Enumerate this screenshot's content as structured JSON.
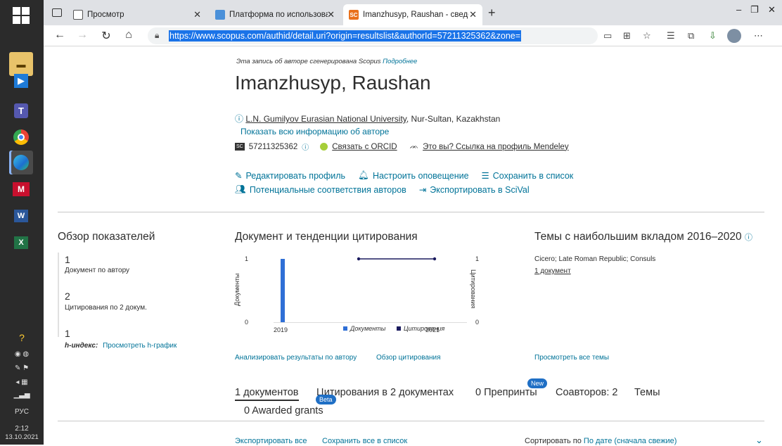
{
  "browser": {
    "tabs": [
      {
        "title": "Просмотр",
        "active": false
      },
      {
        "title": "Платформа по использованию",
        "active": false
      },
      {
        "title": "Imanzhusyp, Raushan - сведени",
        "active": true
      }
    ],
    "new_tab": "+",
    "url": "https://www.scopus.com/authid/detail.uri?origin=resultslist&authorId=57211325362&zone=",
    "window_controls": {
      "minimize": "–",
      "restore": "❐",
      "close": "✕"
    }
  },
  "taskbar": {
    "lang": "РУС",
    "time": "2:12",
    "date": "13.10.2021"
  },
  "author": {
    "generated_note": "Эта запись об авторе сгенерирована Scopus",
    "more_link": "Подробнее",
    "name": "Imanzhusyp, Raushan",
    "affiliation_link": "L.N. Gumilyov Eurasian National University",
    "affiliation_rest": ", Nur-Sultan, Kazakhstan",
    "show_all_info": "Показать всю информацию об авторе",
    "author_id": "57211325362",
    "orcid_link": "Связать с ORCID",
    "mendeley_link": "Это вы? Ссылка на профиль Mendeley"
  },
  "actions": {
    "edit_profile": "Редактировать профиль",
    "set_alert": "Настроить оповещение",
    "save_to_list": "Сохранить в список",
    "potential_matches": "Потенциальные соответствия авторов",
    "export_scival": "Экспортировать в SciVal"
  },
  "metrics": {
    "title": "Обзор показателей",
    "documents_value": "1",
    "documents_label": "Документ по автору",
    "citations_value": "2",
    "citations_label": "Цитирования по 2 докум.",
    "h_value": "1",
    "h_label": "h-индекс:",
    "h_link": "Просмотреть h-график"
  },
  "trends": {
    "title": "Документ и тенденции цитирования",
    "analyze_link": "Анализировать результаты по автору",
    "citation_overview_link": "Обзор цитирования"
  },
  "chart_data": {
    "type": "bar",
    "x": [
      "2019",
      "2020",
      "2021"
    ],
    "series": [
      {
        "name": "Документы",
        "kind": "bar",
        "color": "#2f6fd6",
        "values": [
          1,
          0,
          0
        ]
      },
      {
        "name": "Цитирования",
        "kind": "line",
        "color": "#1b1b5e",
        "values": [
          null,
          1,
          1
        ]
      }
    ],
    "x_tick_labels": [
      "2019",
      "2021"
    ],
    "ylabel_left": "Документы",
    "ylabel_right": "Цитирования",
    "ylim_left": [
      0,
      1
    ],
    "ylim_right": [
      0,
      1
    ],
    "legend": "bottom-center"
  },
  "topics": {
    "title": "Темы с наибольшим вкладом 2016–2020",
    "topic_name": "Cicero; Late Roman Republic; Consuls",
    "topic_docs": "1 документ",
    "view_all": "Просмотреть все темы"
  },
  "doc_tabs": {
    "documents": "1 документов",
    "citations": "Цитирования в 2 документах",
    "beta": "Beta",
    "preprints": "0 Препринты",
    "new": "New",
    "coauthors": "Соавторов: 2",
    "topics": "Темы",
    "awarded": "0 Awarded grants"
  },
  "bottom": {
    "export_all": "Экспортировать все",
    "save_all": "Сохранить все в список",
    "sort_label": "Сортировать по",
    "sort_value": "По дате (сначала свежие)"
  }
}
